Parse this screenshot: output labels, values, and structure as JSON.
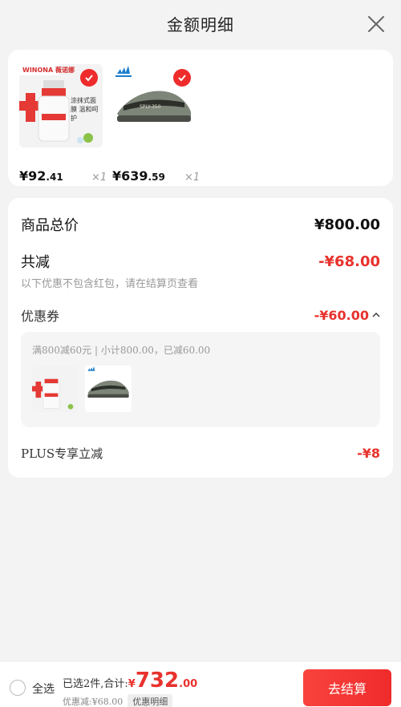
{
  "header": {
    "title": "金额明细"
  },
  "products": [
    {
      "name": "winona-foam",
      "brand_text": "WINONA 薇诺娜",
      "promo_text": "涂抹式面膜 温和呵护",
      "price_int": "¥92",
      "price_dec": ".41",
      "qty": "×1"
    },
    {
      "name": "adidas-yeezy",
      "price_int": "¥639",
      "price_dec": ".59",
      "qty": "×1"
    }
  ],
  "summary": {
    "total_label": "商品总价",
    "total_value": "¥800.00",
    "discount_label": "共减",
    "discount_value": "-¥68.00",
    "discount_note": "以下优惠不包含红包，请在结算页查看",
    "coupon_label": "优惠券",
    "coupon_value": "-¥60.00",
    "coupon_desc": "满800减60元 | 小计800.00，已减60.00",
    "plus_label": "PLUS专享立减",
    "plus_value": "-¥8"
  },
  "bottom": {
    "select_all": "全选",
    "selected_total_label": "已选2件,合计:",
    "currency": "¥",
    "total_int": "732",
    "total_dec": ".00",
    "discount_text": "优惠减:¥68.00",
    "detail_label": "优惠明细",
    "checkout_label": "去结算"
  },
  "colors": {
    "accent": "#ef2b2b",
    "price_red": "#e8322d"
  }
}
